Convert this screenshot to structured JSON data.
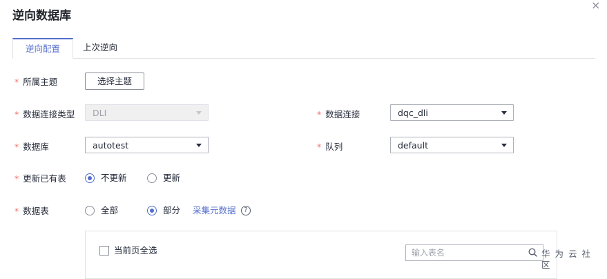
{
  "dialog": {
    "title": "逆向数据库",
    "close_glyph": "×"
  },
  "tabs": [
    {
      "label": "逆向配置",
      "active": true
    },
    {
      "label": "上次逆向",
      "active": false
    }
  ],
  "form": {
    "required_mark": "*",
    "subject": {
      "label": "所属主题",
      "button_label": "选择主题"
    },
    "conn_type": {
      "label": "数据连接类型",
      "value": "DLI",
      "disabled": true
    },
    "connection": {
      "label": "数据连接",
      "value": "dqc_dli"
    },
    "database": {
      "label": "数据库",
      "value": "autotest"
    },
    "queue": {
      "label": "队列",
      "value": "default"
    },
    "update_existing": {
      "label": "更新已有表",
      "options": [
        {
          "label": "不更新",
          "checked": true
        },
        {
          "label": "更新",
          "checked": false
        }
      ]
    },
    "tables": {
      "label": "数据表",
      "options": [
        {
          "label": "全部",
          "checked": false
        },
        {
          "label": "部分",
          "checked": true
        }
      ],
      "collect_link": "采集元数据",
      "help_glyph": "?"
    }
  },
  "table_panel": {
    "select_all_label": "当前页全选",
    "search_placeholder": "输入表名"
  },
  "watermark": "华为云社区",
  "colors": {
    "accent": "#526ecc",
    "required": "#f66f6a"
  }
}
